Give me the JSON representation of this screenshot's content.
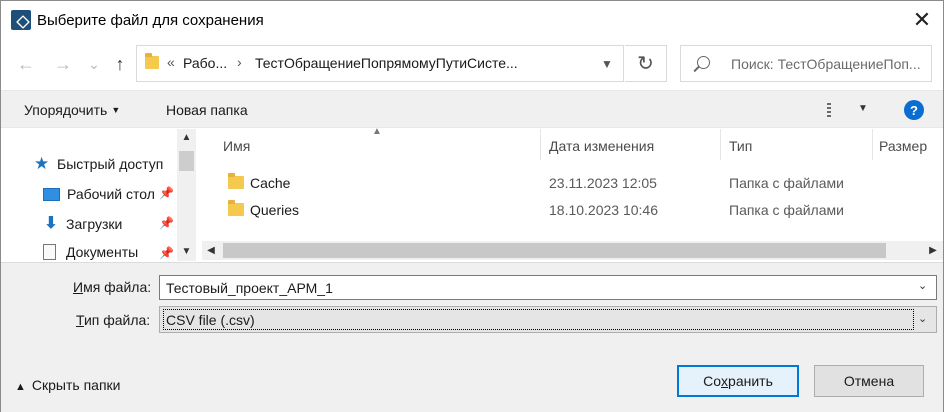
{
  "window": {
    "title": "Выберите файл для сохранения",
    "close_glyph": "✕"
  },
  "nav": {
    "back_glyph": "←",
    "forward_glyph": "→",
    "recent_glyph": "⌄",
    "up_glyph": "↑",
    "breadcrumb_overflow": "«",
    "breadcrumbs": [
      "Рабо...",
      "ТестОбращениеПопрямомуПутиСисте..."
    ],
    "crumb_separator": "›",
    "refresh_glyph": "↻",
    "search_placeholder": "Поиск: ТестОбращениеПоп..."
  },
  "toolbar": {
    "organize_label": "Упорядочить",
    "new_folder_label": "Новая папка",
    "help_glyph": "?"
  },
  "sidebar": {
    "items": [
      {
        "label": "Быстрый доступ",
        "icon": "star-icon",
        "pinned": false
      },
      {
        "label": "Рабочий стол",
        "icon": "desktop-icon",
        "pinned": true
      },
      {
        "label": "Загрузки",
        "icon": "download-icon",
        "pinned": true
      },
      {
        "label": "Документы",
        "icon": "documents-icon",
        "pinned": true
      }
    ]
  },
  "file_list": {
    "columns": [
      "Имя",
      "Дата изменения",
      "Тип",
      "Размер"
    ],
    "rows": [
      {
        "name": "Cache",
        "date": "23.11.2023 12:05",
        "type": "Папка с файлами"
      },
      {
        "name": "Queries",
        "date": "18.10.2023 10:46",
        "type": "Папка с файлами"
      }
    ]
  },
  "form": {
    "filename_label_u": "И",
    "filename_label_rest": "мя файла:",
    "filename_value": "Тестовый_проект_АРМ_1",
    "filetype_label_u": "Т",
    "filetype_label_rest": "ип файла:",
    "filetype_value": "CSV file (.csv)",
    "hide_folders_label": "Скрыть папки",
    "save_label_pre": "Со",
    "save_label_u": "х",
    "save_label_post": "ранить",
    "cancel_label": "Отмена"
  },
  "colors": {
    "accent": "#0078d7",
    "folder": "#f4c94e",
    "help": "#0a6ed1"
  }
}
